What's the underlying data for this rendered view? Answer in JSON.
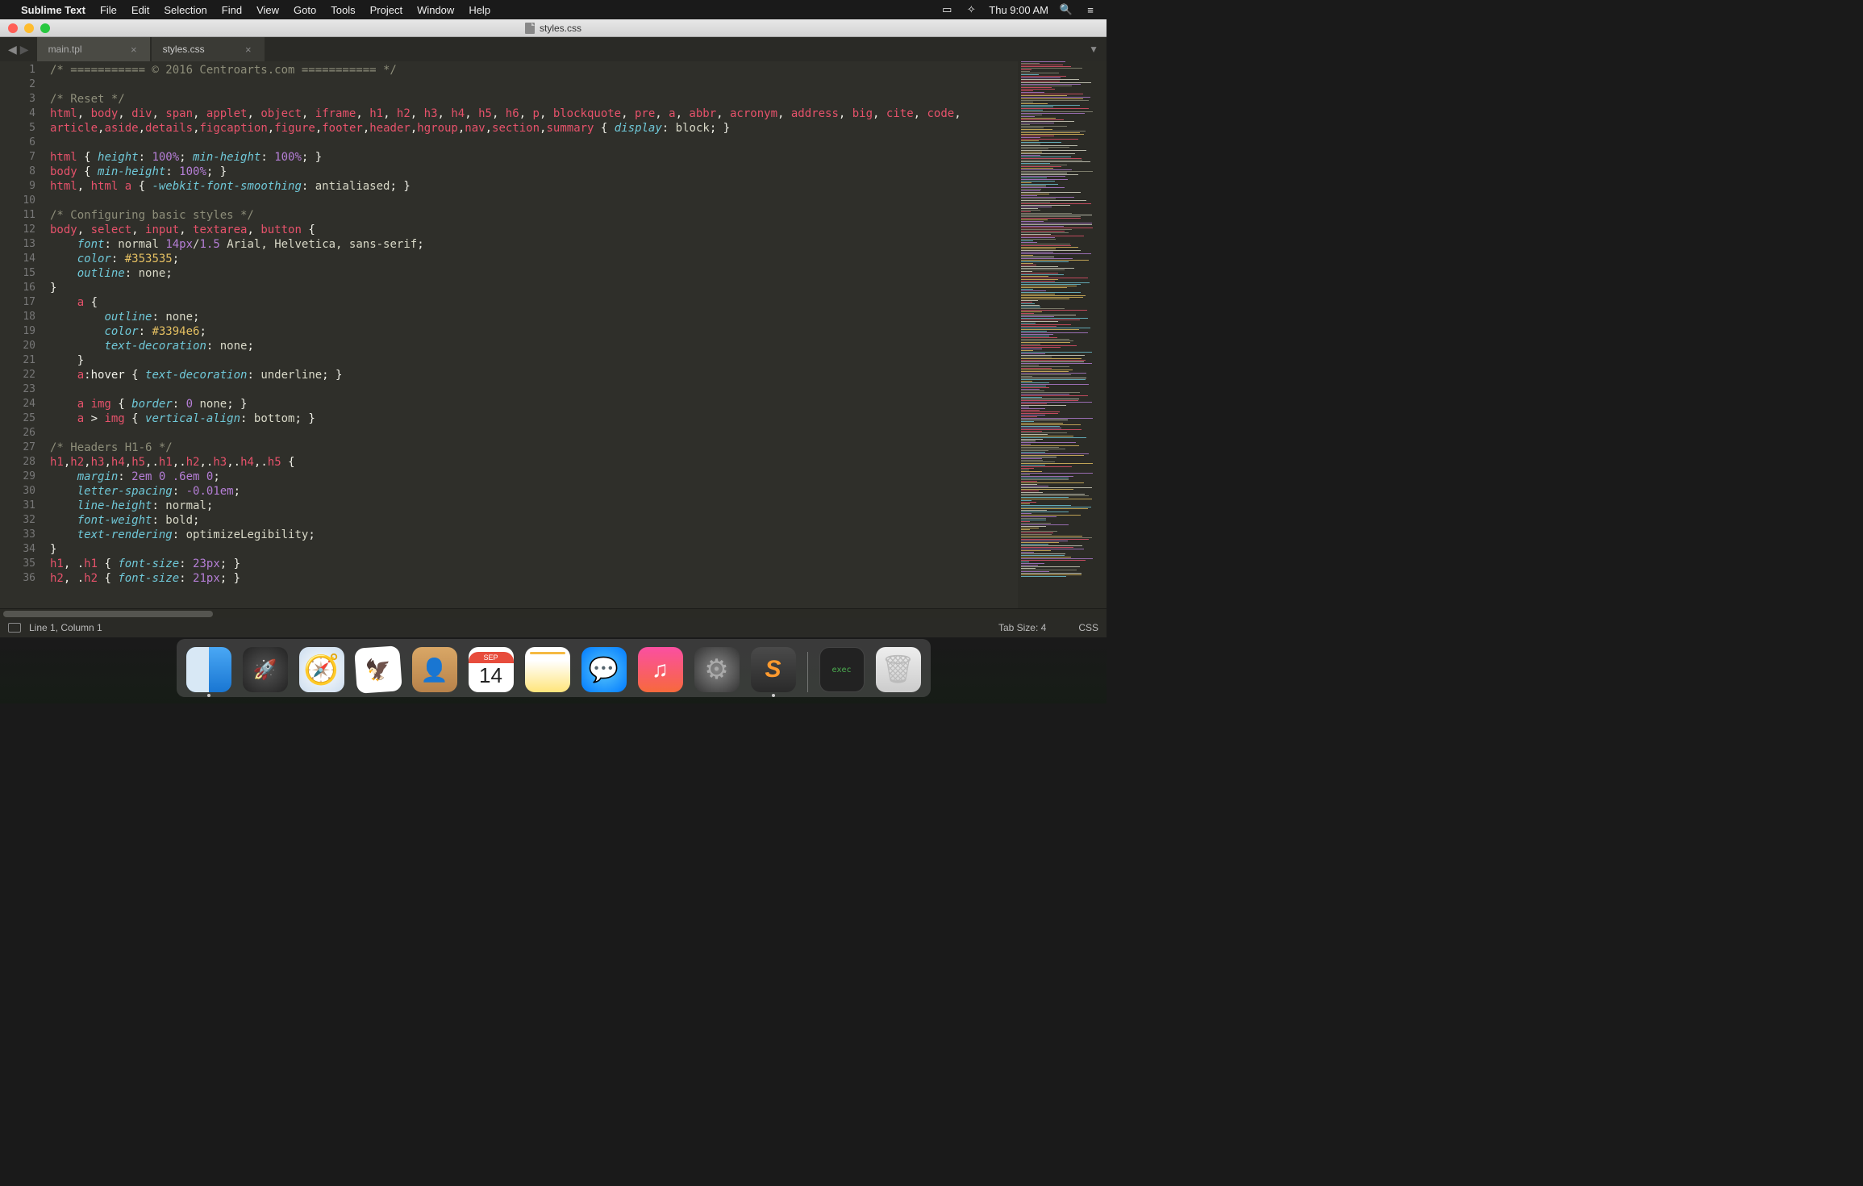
{
  "menubar": {
    "app": "Sublime Text",
    "items": [
      "File",
      "Edit",
      "Selection",
      "Find",
      "View",
      "Goto",
      "Tools",
      "Project",
      "Window",
      "Help"
    ],
    "clock": "Thu 9:00 AM"
  },
  "window": {
    "title": "styles.css"
  },
  "tabs": [
    {
      "label": "main.tpl",
      "active": false
    },
    {
      "label": "styles.css",
      "active": true
    }
  ],
  "gutter_start": 1,
  "gutter_end": 36,
  "code_lines": [
    [
      [
        "c-comment",
        "/* =========== © 2016 Centroarts.com =========== */"
      ]
    ],
    [],
    [
      [
        "c-comment",
        "/* Reset */"
      ]
    ],
    [
      [
        "c-selector",
        "html"
      ],
      [
        "c-punct",
        ", "
      ],
      [
        "c-selector",
        "body"
      ],
      [
        "c-punct",
        ", "
      ],
      [
        "c-selector",
        "div"
      ],
      [
        "c-punct",
        ", "
      ],
      [
        "c-selector",
        "span"
      ],
      [
        "c-punct",
        ", "
      ],
      [
        "c-selector",
        "applet"
      ],
      [
        "c-punct",
        ", "
      ],
      [
        "c-selector",
        "object"
      ],
      [
        "c-punct",
        ", "
      ],
      [
        "c-selector",
        "iframe"
      ],
      [
        "c-punct",
        ", "
      ],
      [
        "c-selector",
        "h1"
      ],
      [
        "c-punct",
        ", "
      ],
      [
        "c-selector",
        "h2"
      ],
      [
        "c-punct",
        ", "
      ],
      [
        "c-selector",
        "h3"
      ],
      [
        "c-punct",
        ", "
      ],
      [
        "c-selector",
        "h4"
      ],
      [
        "c-punct",
        ", "
      ],
      [
        "c-selector",
        "h5"
      ],
      [
        "c-punct",
        ", "
      ],
      [
        "c-selector",
        "h6"
      ],
      [
        "c-punct",
        ", "
      ],
      [
        "c-selector",
        "p"
      ],
      [
        "c-punct",
        ", "
      ],
      [
        "c-selector",
        "blockquote"
      ],
      [
        "c-punct",
        ", "
      ],
      [
        "c-selector",
        "pre"
      ],
      [
        "c-punct",
        ", "
      ],
      [
        "c-selector",
        "a"
      ],
      [
        "c-punct",
        ", "
      ],
      [
        "c-selector",
        "abbr"
      ],
      [
        "c-punct",
        ", "
      ],
      [
        "c-selector",
        "acronym"
      ],
      [
        "c-punct",
        ", "
      ],
      [
        "c-selector",
        "address"
      ],
      [
        "c-punct",
        ", "
      ],
      [
        "c-selector",
        "big"
      ],
      [
        "c-punct",
        ", "
      ],
      [
        "c-selector",
        "cite"
      ],
      [
        "c-punct",
        ", "
      ],
      [
        "c-selector",
        "code"
      ],
      [
        "c-punct",
        ", "
      ]
    ],
    [
      [
        "c-selector",
        "article"
      ],
      [
        "c-punct",
        ","
      ],
      [
        "c-selector",
        "aside"
      ],
      [
        "c-punct",
        ","
      ],
      [
        "c-selector",
        "details"
      ],
      [
        "c-punct",
        ","
      ],
      [
        "c-selector",
        "figcaption"
      ],
      [
        "c-punct",
        ","
      ],
      [
        "c-selector",
        "figure"
      ],
      [
        "c-punct",
        ","
      ],
      [
        "c-selector",
        "footer"
      ],
      [
        "c-punct",
        ","
      ],
      [
        "c-selector",
        "header"
      ],
      [
        "c-punct",
        ","
      ],
      [
        "c-selector",
        "hgroup"
      ],
      [
        "c-punct",
        ","
      ],
      [
        "c-selector",
        "nav"
      ],
      [
        "c-punct",
        ","
      ],
      [
        "c-selector",
        "section"
      ],
      [
        "c-punct",
        ","
      ],
      [
        "c-selector",
        "summary "
      ],
      [
        "c-punct",
        "{ "
      ],
      [
        "c-prop",
        "display"
      ],
      [
        "c-punct",
        ": "
      ],
      [
        "c-value",
        "block"
      ],
      [
        "c-punct",
        "; }"
      ]
    ],
    [],
    [
      [
        "c-selector",
        "html "
      ],
      [
        "c-punct",
        "{ "
      ],
      [
        "c-prop",
        "height"
      ],
      [
        "c-punct",
        ": "
      ],
      [
        "c-number",
        "100%"
      ],
      [
        "c-punct",
        "; "
      ],
      [
        "c-prop",
        "min-height"
      ],
      [
        "c-punct",
        ": "
      ],
      [
        "c-number",
        "100%"
      ],
      [
        "c-punct",
        "; }"
      ]
    ],
    [
      [
        "c-selector",
        "body "
      ],
      [
        "c-punct",
        "{ "
      ],
      [
        "c-prop",
        "min-height"
      ],
      [
        "c-punct",
        ": "
      ],
      [
        "c-number",
        "100%"
      ],
      [
        "c-punct",
        "; }"
      ]
    ],
    [
      [
        "c-selector",
        "html"
      ],
      [
        "c-punct",
        ", "
      ],
      [
        "c-selector",
        "html a "
      ],
      [
        "c-punct",
        "{ "
      ],
      [
        "c-prop",
        "-webkit-font-smoothing"
      ],
      [
        "c-punct",
        ": "
      ],
      [
        "c-value",
        "antialiased"
      ],
      [
        "c-punct",
        "; }"
      ]
    ],
    [],
    [
      [
        "c-comment",
        "/* Configuring basic styles */"
      ]
    ],
    [
      [
        "c-selector",
        "body"
      ],
      [
        "c-punct",
        ", "
      ],
      [
        "c-selector",
        "select"
      ],
      [
        "c-punct",
        ", "
      ],
      [
        "c-selector",
        "input"
      ],
      [
        "c-punct",
        ", "
      ],
      [
        "c-selector",
        "textarea"
      ],
      [
        "c-punct",
        ", "
      ],
      [
        "c-selector",
        "button "
      ],
      [
        "c-punct",
        "{"
      ]
    ],
    [
      [
        "c-punct",
        "    "
      ],
      [
        "c-prop",
        "font"
      ],
      [
        "c-punct",
        ": "
      ],
      [
        "c-value",
        "normal "
      ],
      [
        "c-number",
        "14px"
      ],
      [
        "c-value",
        "/"
      ],
      [
        "c-number",
        "1.5"
      ],
      [
        "c-value",
        " Arial, Helvetica, sans-serif"
      ],
      [
        "c-punct",
        ";"
      ]
    ],
    [
      [
        "c-punct",
        "    "
      ],
      [
        "c-prop",
        "color"
      ],
      [
        "c-punct",
        ": "
      ],
      [
        "c-string",
        "#353535"
      ],
      [
        "c-punct",
        ";"
      ]
    ],
    [
      [
        "c-punct",
        "    "
      ],
      [
        "c-prop",
        "outline"
      ],
      [
        "c-punct",
        ": "
      ],
      [
        "c-value",
        "none"
      ],
      [
        "c-punct",
        ";"
      ]
    ],
    [
      [
        "c-punct",
        "}"
      ]
    ],
    [
      [
        "c-punct",
        "    "
      ],
      [
        "c-selector",
        "a "
      ],
      [
        "c-punct",
        "{"
      ]
    ],
    [
      [
        "c-punct",
        "        "
      ],
      [
        "c-prop",
        "outline"
      ],
      [
        "c-punct",
        ": "
      ],
      [
        "c-value",
        "none"
      ],
      [
        "c-punct",
        ";"
      ]
    ],
    [
      [
        "c-punct",
        "        "
      ],
      [
        "c-prop",
        "color"
      ],
      [
        "c-punct",
        ": "
      ],
      [
        "c-string",
        "#3394e6"
      ],
      [
        "c-punct",
        ";"
      ]
    ],
    [
      [
        "c-punct",
        "        "
      ],
      [
        "c-prop",
        "text-decoration"
      ],
      [
        "c-punct",
        ": "
      ],
      [
        "c-value",
        "none"
      ],
      [
        "c-punct",
        ";"
      ]
    ],
    [
      [
        "c-punct",
        "    }"
      ]
    ],
    [
      [
        "c-punct",
        "    "
      ],
      [
        "c-selector",
        "a"
      ],
      [
        "c-punct",
        ":hover { "
      ],
      [
        "c-prop",
        "text-decoration"
      ],
      [
        "c-punct",
        ": "
      ],
      [
        "c-value",
        "underline"
      ],
      [
        "c-punct",
        "; }"
      ]
    ],
    [],
    [
      [
        "c-punct",
        "    "
      ],
      [
        "c-selector",
        "a img "
      ],
      [
        "c-punct",
        "{ "
      ],
      [
        "c-prop",
        "border"
      ],
      [
        "c-punct",
        ": "
      ],
      [
        "c-number",
        "0"
      ],
      [
        "c-value",
        " none"
      ],
      [
        "c-punct",
        "; }"
      ]
    ],
    [
      [
        "c-punct",
        "    "
      ],
      [
        "c-selector",
        "a "
      ],
      [
        "c-punct",
        "> "
      ],
      [
        "c-selector",
        "img "
      ],
      [
        "c-punct",
        "{ "
      ],
      [
        "c-prop",
        "vertical-align"
      ],
      [
        "c-punct",
        ": "
      ],
      [
        "c-value",
        "bottom"
      ],
      [
        "c-punct",
        "; }"
      ]
    ],
    [],
    [
      [
        "c-comment",
        "/* Headers H1-6 */"
      ]
    ],
    [
      [
        "c-selector",
        "h1"
      ],
      [
        "c-punct",
        ","
      ],
      [
        "c-selector",
        "h2"
      ],
      [
        "c-punct",
        ","
      ],
      [
        "c-selector",
        "h3"
      ],
      [
        "c-punct",
        ","
      ],
      [
        "c-selector",
        "h4"
      ],
      [
        "c-punct",
        ","
      ],
      [
        "c-selector",
        "h5"
      ],
      [
        "c-punct",
        ",."
      ],
      [
        "c-selector",
        "h1"
      ],
      [
        "c-punct",
        ",."
      ],
      [
        "c-selector",
        "h2"
      ],
      [
        "c-punct",
        ",."
      ],
      [
        "c-selector",
        "h3"
      ],
      [
        "c-punct",
        ",."
      ],
      [
        "c-selector",
        "h4"
      ],
      [
        "c-punct",
        ",."
      ],
      [
        "c-selector",
        "h5 "
      ],
      [
        "c-punct",
        "{"
      ]
    ],
    [
      [
        "c-punct",
        "    "
      ],
      [
        "c-prop",
        "margin"
      ],
      [
        "c-punct",
        ": "
      ],
      [
        "c-number",
        "2em 0 .6em 0"
      ],
      [
        "c-punct",
        ";"
      ]
    ],
    [
      [
        "c-punct",
        "    "
      ],
      [
        "c-prop",
        "letter-spacing"
      ],
      [
        "c-punct",
        ": "
      ],
      [
        "c-number",
        "-0.01em"
      ],
      [
        "c-punct",
        ";"
      ]
    ],
    [
      [
        "c-punct",
        "    "
      ],
      [
        "c-prop",
        "line-height"
      ],
      [
        "c-punct",
        ": "
      ],
      [
        "c-value",
        "normal"
      ],
      [
        "c-punct",
        ";"
      ]
    ],
    [
      [
        "c-punct",
        "    "
      ],
      [
        "c-prop",
        "font-weight"
      ],
      [
        "c-punct",
        ": "
      ],
      [
        "c-value",
        "bold"
      ],
      [
        "c-punct",
        ";"
      ]
    ],
    [
      [
        "c-punct",
        "    "
      ],
      [
        "c-prop",
        "text-rendering"
      ],
      [
        "c-punct",
        ": "
      ],
      [
        "c-value",
        "optimizeLegibility"
      ],
      [
        "c-punct",
        ";"
      ]
    ],
    [
      [
        "c-punct",
        "}"
      ]
    ],
    [
      [
        "c-selector",
        "h1"
      ],
      [
        "c-punct",
        ", ."
      ],
      [
        "c-selector",
        "h1 "
      ],
      [
        "c-punct",
        "{ "
      ],
      [
        "c-prop",
        "font-size"
      ],
      [
        "c-punct",
        ": "
      ],
      [
        "c-number",
        "23px"
      ],
      [
        "c-punct",
        "; }"
      ]
    ],
    [
      [
        "c-selector",
        "h2"
      ],
      [
        "c-punct",
        ", ."
      ],
      [
        "c-selector",
        "h2 "
      ],
      [
        "c-punct",
        "{ "
      ],
      [
        "c-prop",
        "font-size"
      ],
      [
        "c-punct",
        ": "
      ],
      [
        "c-number",
        "21px"
      ],
      [
        "c-punct",
        "; }"
      ]
    ]
  ],
  "status": {
    "position": "Line 1, Column 1",
    "tab_size": "Tab Size: 4",
    "syntax": "CSS"
  },
  "dock": {
    "calendar_month": "SEP",
    "calendar_day": "14",
    "term_label": "exec"
  }
}
